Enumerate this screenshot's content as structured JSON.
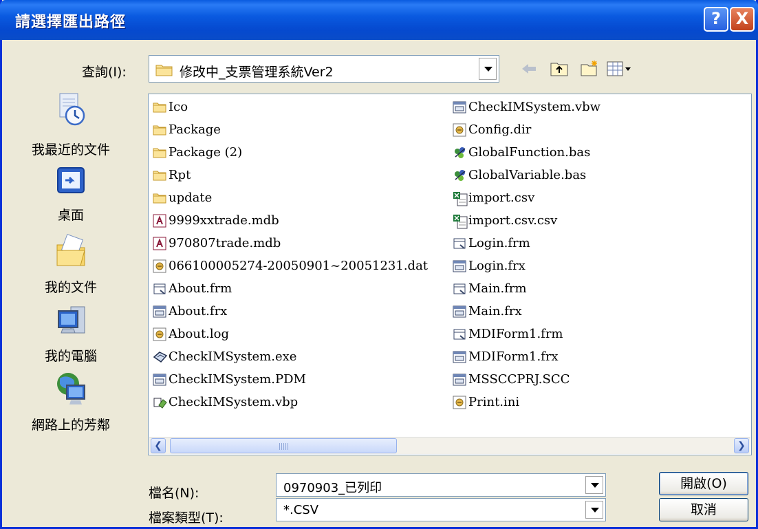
{
  "window": {
    "title": "請選擇匯出路徑"
  },
  "lookin": {
    "label": "查詢(I):",
    "value": "修改中_支票管理系統Ver2"
  },
  "places": [
    {
      "label": "我最近的文件",
      "icon": "recent-documents-icon"
    },
    {
      "label": "桌面",
      "icon": "desktop-icon"
    },
    {
      "label": "我的文件",
      "icon": "my-documents-icon"
    },
    {
      "label": "我的電腦",
      "icon": "my-computer-icon"
    },
    {
      "label": "網路上的芳鄰",
      "icon": "network-places-icon"
    }
  ],
  "files": {
    "left": [
      {
        "name": "Ico",
        "icon": "folder"
      },
      {
        "name": "Package",
        "icon": "folder"
      },
      {
        "name": "Package (2)",
        "icon": "folder"
      },
      {
        "name": "Rpt",
        "icon": "folder"
      },
      {
        "name": "update",
        "icon": "folder"
      },
      {
        "name": "9999xxtrade.mdb",
        "icon": "access"
      },
      {
        "name": "970807trade.mdb",
        "icon": "access"
      },
      {
        "name": "066100005274-20050901~20051231.dat",
        "icon": "doc"
      },
      {
        "name": "About.frm",
        "icon": "form"
      },
      {
        "name": "About.frx",
        "icon": "frx"
      },
      {
        "name": "About.log",
        "icon": "doc"
      },
      {
        "name": "CheckIMSystem.exe",
        "icon": "exe"
      },
      {
        "name": "CheckIMSystem.PDM",
        "icon": "frx"
      },
      {
        "name": "CheckIMSystem.vbp",
        "icon": "vbp"
      }
    ],
    "right": [
      {
        "name": "CheckIMSystem.vbw",
        "icon": "frx"
      },
      {
        "name": "Config.dir",
        "icon": "doc"
      },
      {
        "name": "GlobalFunction.bas",
        "icon": "bas"
      },
      {
        "name": "GlobalVariable.bas",
        "icon": "bas"
      },
      {
        "name": "import.csv",
        "icon": "csv"
      },
      {
        "name": "import.csv.csv",
        "icon": "csv"
      },
      {
        "name": "Login.frm",
        "icon": "form"
      },
      {
        "name": "Login.frx",
        "icon": "frx"
      },
      {
        "name": "Main.frm",
        "icon": "form"
      },
      {
        "name": "Main.frx",
        "icon": "frx"
      },
      {
        "name": "MDIForm1.frm",
        "icon": "form"
      },
      {
        "name": "MDIForm1.frx",
        "icon": "frx"
      },
      {
        "name": "MSSCCPRJ.SCC",
        "icon": "frx"
      },
      {
        "name": "Print.ini",
        "icon": "doc"
      }
    ]
  },
  "filename": {
    "label": "檔名(N):",
    "value": "0970903_已列印"
  },
  "filetype": {
    "label": "檔案類型(T):",
    "value": "*.CSV"
  },
  "buttons": {
    "open": "開啟(O)",
    "cancel": "取消"
  },
  "titlebar_buttons": {
    "help": "?",
    "close": "X"
  }
}
